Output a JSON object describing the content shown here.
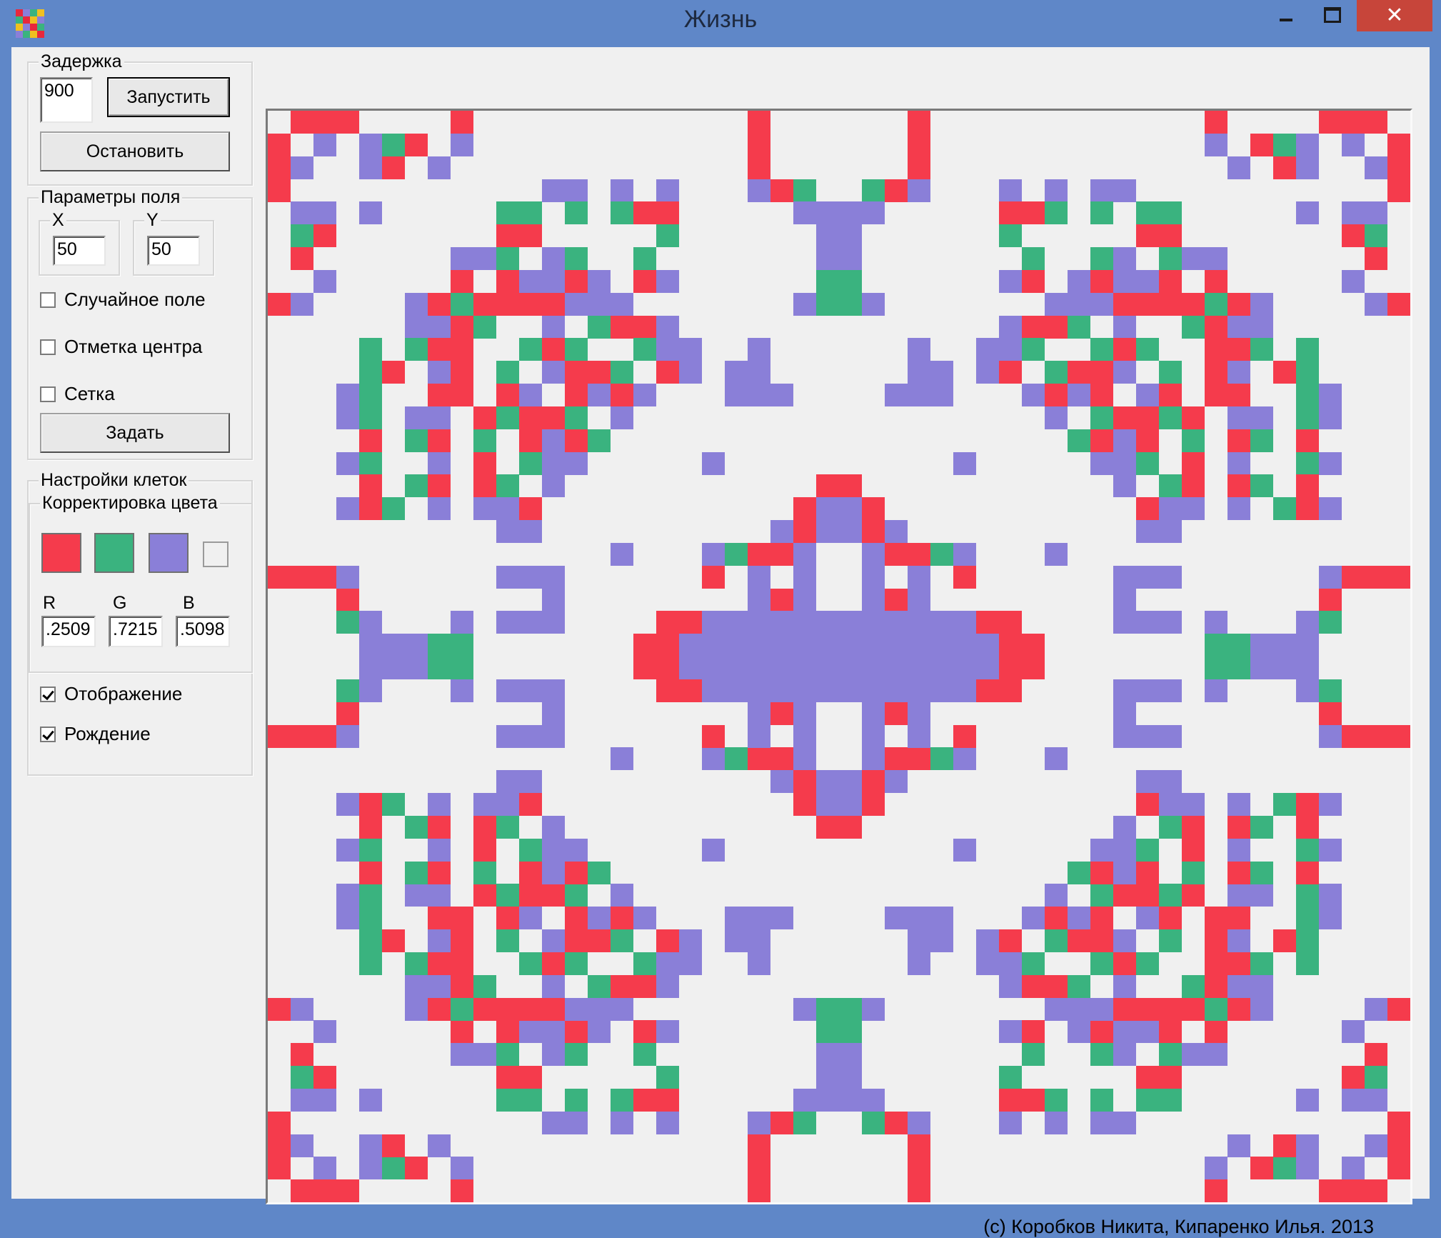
{
  "window": {
    "title": "Жизнь"
  },
  "titlebar": {
    "minimize": "",
    "maximize": "",
    "close": "✕"
  },
  "delay_group": {
    "legend": "Задержка",
    "delay_value": "900",
    "start_label": "Запустить",
    "stop_label": "Остановить"
  },
  "field_params": {
    "legend": "Параметры поля",
    "x_legend": "X",
    "y_legend": "Y",
    "x_value": "50",
    "y_value": "50",
    "random_label": "Случайное поле",
    "center_label": "Отметка центра",
    "grid_label": "Сетка",
    "apply_label": "Задать",
    "random_checked": false,
    "center_checked": false,
    "grid_checked": false
  },
  "cell_settings": {
    "legend": "Настройки клеток",
    "color_legend": "Корректировка цвета",
    "swatches": [
      "#f53b4c",
      "#3ab37f",
      "#8a7fd8"
    ],
    "r_label": "R",
    "g_label": "G",
    "b_label": "B",
    "r_value": ".2509",
    "g_value": ".7215",
    "b_value": ".5098",
    "display_label": "Отображение",
    "birth_label": "Рождение",
    "display_checked": true,
    "birth_checked": true
  },
  "colors": {
    "red": "#f53b4c",
    "green": "#3ab37f",
    "purple": "#8a7fd8",
    "titlebar": "#5f87c8",
    "close": "#c7453a"
  },
  "grid": {
    "cols": 50,
    "rows": 48
  },
  "footer": {
    "copyright": "(c) Коробков Никита, Кипаренко Илья. 2013"
  }
}
